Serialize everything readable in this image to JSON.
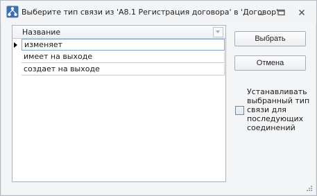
{
  "window": {
    "title": "Выберите тип связи из 'А8.1 Регистрация договора' в 'Договор'"
  },
  "grid": {
    "column_header": "Название",
    "rows": [
      {
        "label": "изменяет",
        "current": true
      },
      {
        "label": "имеет на выходе",
        "current": false
      },
      {
        "label": "создает на выходе",
        "current": false
      }
    ]
  },
  "buttons": {
    "select": "Выбрать",
    "cancel": "Отмена"
  },
  "option": {
    "label": "Устанавливать выбранный тип связи для последующих соединений",
    "checked": false
  },
  "icons": {
    "app": "network-nodes-icon",
    "minimize": "minimize-icon",
    "restore": "restore-icon",
    "close": "close-icon",
    "current_row": "row-pointer-icon",
    "filter": "filter-dropdown-icon",
    "resize": "resize-grip-icon"
  },
  "colors": {
    "accent": "#5f87c7",
    "focus_border": "#7fa3d6"
  }
}
